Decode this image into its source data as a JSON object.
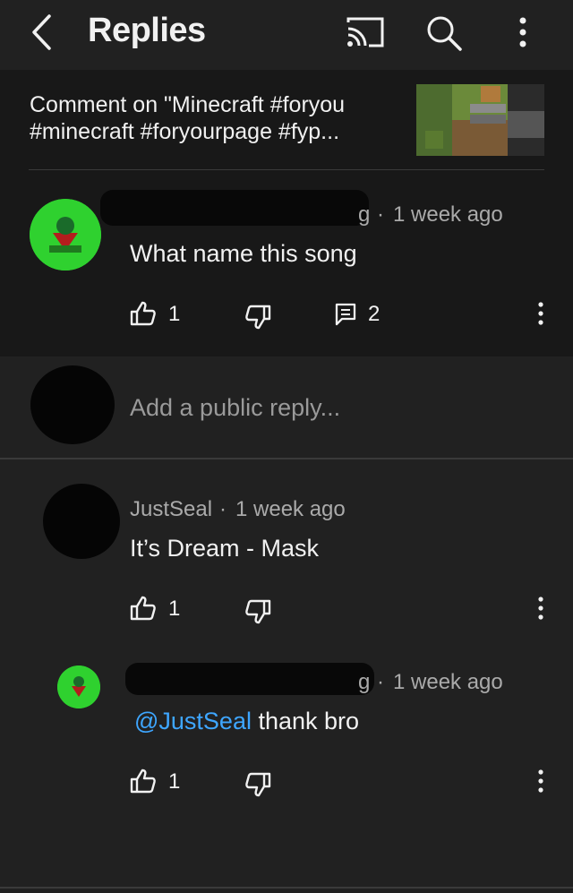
{
  "header": {
    "title": "Replies",
    "back_icon": "back-arrow-icon",
    "cast_icon": "cast-icon",
    "search_icon": "search-icon",
    "menu_icon": "more-vert-icon"
  },
  "context": {
    "title_line1": "Comment on \"Minecraft #foryou",
    "title_line2": "#minecraft #foryourpage #fyp..."
  },
  "comment": {
    "author_suffix": "g",
    "time": "1 week ago",
    "text": "What name this song",
    "likes": "1",
    "replies": "2"
  },
  "reply_input": {
    "placeholder": "Add a public reply..."
  },
  "replies": [
    {
      "author": "JustSeal",
      "time": "1 week ago",
      "text": "It’s Dream - Mask",
      "likes": "1"
    },
    {
      "author_suffix": "g",
      "time": "1 week ago",
      "mention": "@JustSeal",
      "text": "thank bro",
      "likes": "1"
    }
  ],
  "colors": {
    "background": "#212121",
    "highlight": "#181818",
    "mention": "#3ea6ff",
    "avatar": "#2fd12f"
  }
}
